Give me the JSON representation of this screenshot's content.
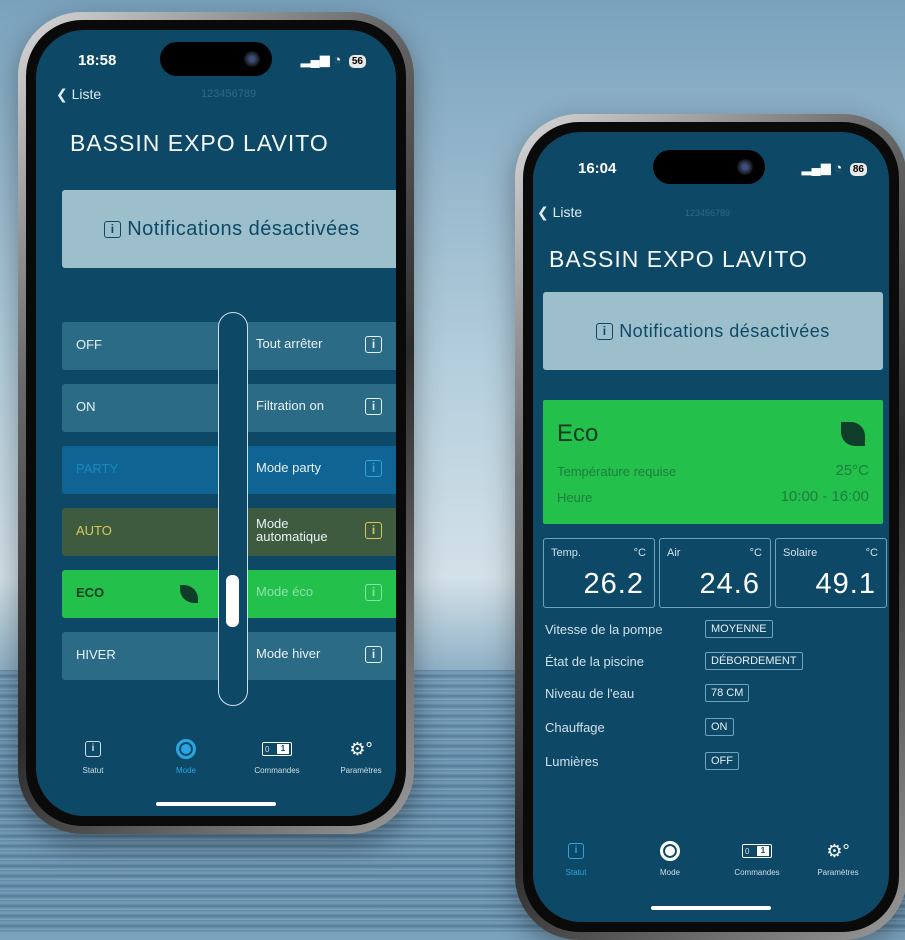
{
  "left_phone": {
    "status_time": "18:58",
    "battery": "56",
    "back_label": "Liste",
    "serial": "123456789",
    "title": "BASSIN EXPO LAVITO",
    "notification": "Notifications désactivées",
    "modes": [
      {
        "name": "OFF",
        "desc": "Tout arrêter",
        "bg": "#2c6b85"
      },
      {
        "name": "ON",
        "desc": "Filtration on",
        "bg": "#2c6b85"
      },
      {
        "name": "PARTY",
        "desc": "Mode party",
        "bg": "#0f6494",
        "name_color": "#1e86bf"
      },
      {
        "name": "AUTO",
        "desc": "Mode automatique",
        "bg": "#3f5b3f",
        "name_color": "#d8c85a"
      },
      {
        "name": "ECO",
        "desc": "Mode éco",
        "bg": "#23c14c",
        "selected": true
      },
      {
        "name": "HIVER",
        "desc": "Mode hiver",
        "bg": "#2c6b85"
      }
    ],
    "tabs": [
      {
        "label": "Statut",
        "icon": "info-icon"
      },
      {
        "label": "Mode",
        "icon": "mode-circle-icon",
        "active": true
      },
      {
        "label": "Commandes",
        "icon": "toggle-icon"
      },
      {
        "label": "Paramètres",
        "icon": "gear-icon"
      }
    ]
  },
  "right_phone": {
    "status_time": "16:04",
    "battery": "86",
    "back_label": "Liste",
    "serial": "123456789",
    "title": "BASSIN EXPO LAVITO",
    "notification": "Notifications désactivées",
    "eco_card": {
      "mode": "Eco",
      "temp_label": "Température requise",
      "temp_value": "25°C",
      "hour_label": "Heure",
      "hour_value": "10:00 - 16:00"
    },
    "readings": [
      {
        "label": "Temp.",
        "unit": "°C",
        "value": "26.2"
      },
      {
        "label": "Air",
        "unit": "°C",
        "value": "24.6"
      },
      {
        "label": "Solaire",
        "unit": "°C",
        "value": "49.1"
      }
    ],
    "status_rows": [
      {
        "label": "Vitesse de la pompe",
        "value": "MOYENNE"
      },
      {
        "label": "État de la piscine",
        "value": "DÉBORDEMENT"
      },
      {
        "label": "Niveau de l'eau",
        "value": "78 CM"
      },
      {
        "label": "Chauffage",
        "value": "ON"
      },
      {
        "label": "Lumières",
        "value": "OFF"
      }
    ],
    "tabs": [
      {
        "label": "Statut",
        "icon": "info-icon",
        "active": true
      },
      {
        "label": "Mode",
        "icon": "mode-circle-icon"
      },
      {
        "label": "Commandes",
        "icon": "toggle-icon"
      },
      {
        "label": "Paramètres",
        "icon": "gear-icon"
      }
    ]
  }
}
